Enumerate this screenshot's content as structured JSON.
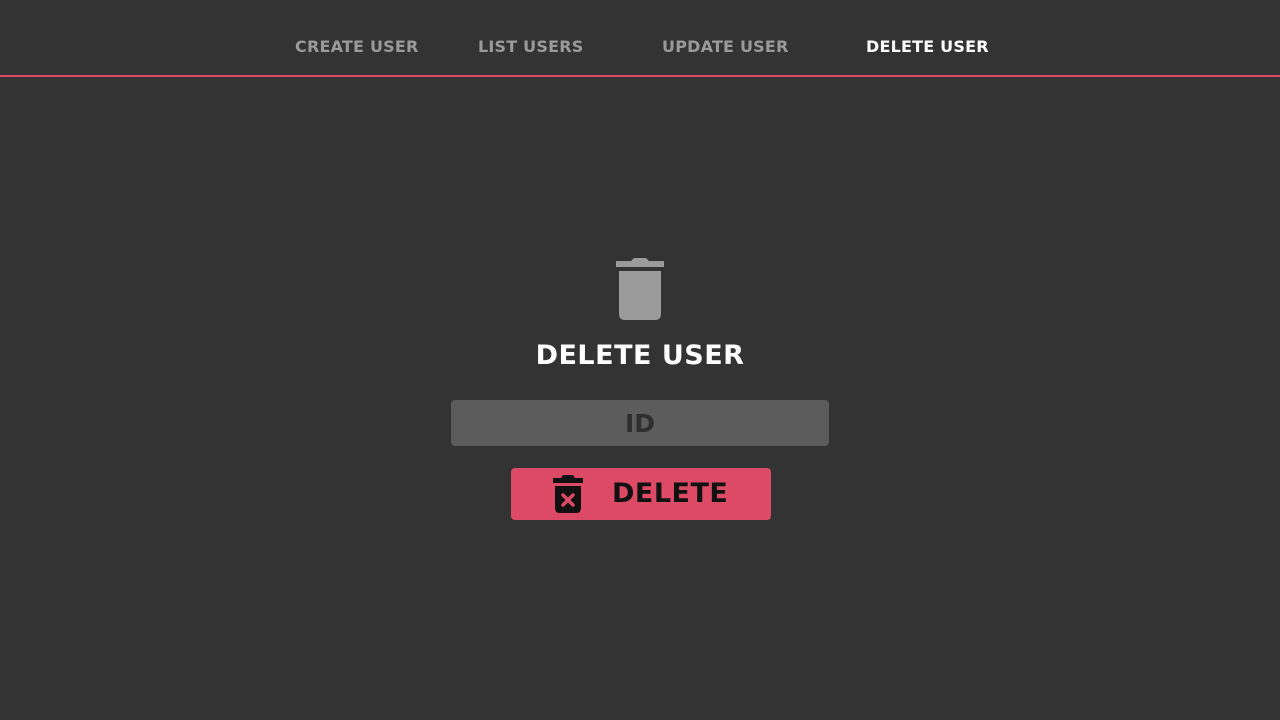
{
  "nav": {
    "tabs": [
      {
        "label": "CREATE USER",
        "active": false
      },
      {
        "label": "LIST USERS",
        "active": false
      },
      {
        "label": "UPDATE USER",
        "active": false
      },
      {
        "label": "DELETE USER",
        "active": true
      }
    ]
  },
  "main": {
    "hero_icon": "trash-icon",
    "title": "DELETE USER",
    "id_input": {
      "placeholder": "ID",
      "value": ""
    },
    "delete_button": {
      "label": "DELETE",
      "icon": "trash-x-icon"
    }
  },
  "colors": {
    "background": "#333333",
    "accent": "#dc4a66",
    "input_background": "#5c5c5c",
    "muted_text": "#9a9a9a",
    "icon_gray": "#9b9b9b"
  }
}
